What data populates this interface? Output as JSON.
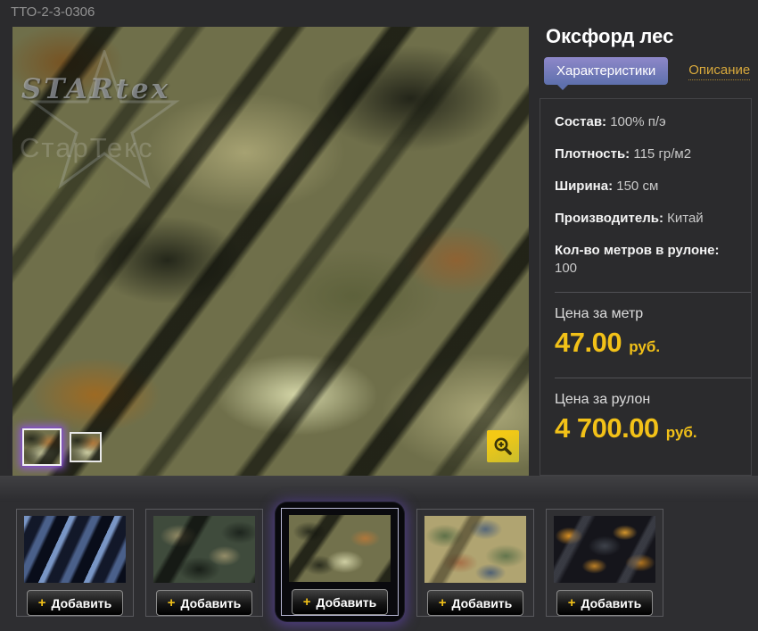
{
  "page": {
    "product_code": "ТТО-2-3-0306"
  },
  "product": {
    "title": "Оксфорд лес",
    "tabs": [
      {
        "label": "Характеристики",
        "active": true
      },
      {
        "label": "Описание",
        "active": false
      }
    ],
    "characteristics": [
      {
        "label": "Состав:",
        "value": "100% п/э"
      },
      {
        "label": "Плотность:",
        "value": "115 гр/м2"
      },
      {
        "label": "Ширина:",
        "value": "150 см"
      },
      {
        "label": "Производитель:",
        "value": "Китай"
      },
      {
        "label": "Кол-во метров в рулоне:",
        "value": "100"
      }
    ],
    "prices": [
      {
        "label": "Цена за метр",
        "value": "47.00",
        "currency": "руб."
      },
      {
        "label": "Цена за рулон",
        "value": "4 700.00",
        "currency": "руб."
      }
    ],
    "watermark": {
      "line1": "STARtex",
      "line2": "СтарТекс"
    }
  },
  "related": {
    "plus": "+",
    "add_label": "Добавить",
    "items": [
      {
        "pattern": "blue-camo",
        "selected": false
      },
      {
        "pattern": "dark-green-camo",
        "selected": false
      },
      {
        "pattern": "forest-camo",
        "selected": true
      },
      {
        "pattern": "classic-camo",
        "selected": false
      },
      {
        "pattern": "autumn-leaves-camo",
        "selected": false
      }
    ]
  },
  "colors": {
    "accent_yellow": "#f2c118",
    "tab_gradient_top": "#8e88c9",
    "tab_gradient_bottom": "#5e70ad",
    "description_link": "#d8a93c",
    "selection_glow": "#6848c0",
    "background": "#2b2b2d"
  }
}
